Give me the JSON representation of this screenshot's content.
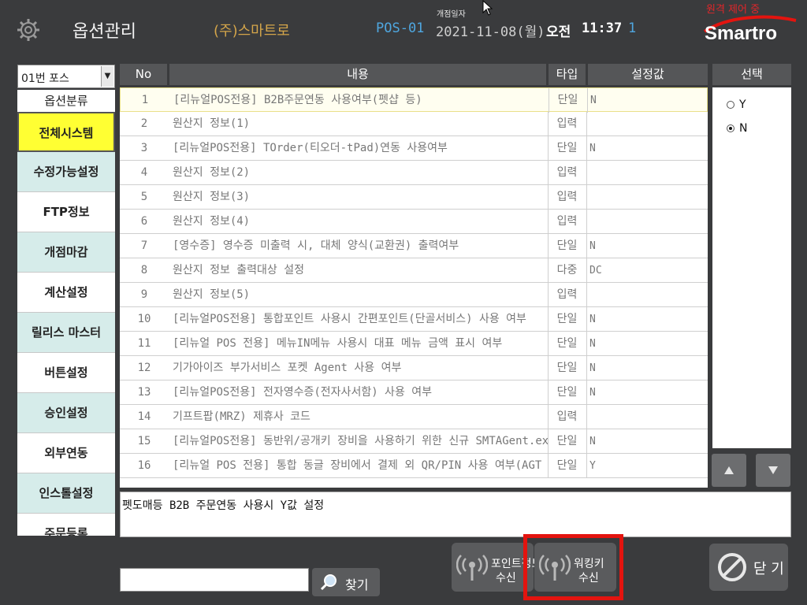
{
  "header": {
    "title": "옵션관리",
    "company": "(주)스마트로",
    "pos_id": "POS-01",
    "open_label": "개점일자",
    "date": "2021-11-08(월)",
    "ampm": "오전",
    "time": "11:37",
    "counter": "1",
    "remote_status": "원격 제어 중",
    "logo": "Smartro"
  },
  "left": {
    "pos_select": "01번 포스",
    "category_header": "옵션분류",
    "categories": [
      "전체시스템",
      "수정가능설정",
      "FTP정보",
      "개점마감",
      "계산설정",
      "릴리스 마스터",
      "버튼설정",
      "승인설정",
      "외부연동",
      "인스톨설정",
      "주문등록"
    ]
  },
  "table": {
    "headers": {
      "no": "No",
      "desc": "내용",
      "type": "타입",
      "value": "설정값"
    },
    "rows": [
      {
        "no": "1",
        "desc": "[리뉴얼POS전용] B2B주문연동 사용여부(펫샵 등)",
        "type": "단일",
        "value": "N"
      },
      {
        "no": "2",
        "desc": "원산지 정보(1)",
        "type": "입력",
        "value": ""
      },
      {
        "no": "3",
        "desc": "[리뉴얼POS전용] TOrder(티오더-tPad)연동 사용여부",
        "type": "단일",
        "value": "N"
      },
      {
        "no": "4",
        "desc": "원산지 정보(2)",
        "type": "입력",
        "value": ""
      },
      {
        "no": "5",
        "desc": "원산지 정보(3)",
        "type": "입력",
        "value": ""
      },
      {
        "no": "6",
        "desc": "원산지 정보(4)",
        "type": "입력",
        "value": ""
      },
      {
        "no": "7",
        "desc": "[영수증] 영수증 미출력 시, 대체 양식(교환권) 출력여부",
        "type": "단일",
        "value": "N"
      },
      {
        "no": "8",
        "desc": "원산지 정보 출력대상 설정",
        "type": "다중",
        "value": "DC"
      },
      {
        "no": "9",
        "desc": "원산지 정보(5)",
        "type": "입력",
        "value": ""
      },
      {
        "no": "10",
        "desc": "[리뉴얼POS전용] 통합포인트 사용시 간편포인트(단골서비스) 사용 여부",
        "type": "단일",
        "value": "N"
      },
      {
        "no": "11",
        "desc": "[리뉴얼 POS 전용] 메뉴IN메뉴 사용시 대표 메뉴 금액 표시 여부",
        "type": "단일",
        "value": "N"
      },
      {
        "no": "12",
        "desc": "기가아이즈 부가서비스 포켓 Agent 사용 여부",
        "type": "단일",
        "value": "N"
      },
      {
        "no": "13",
        "desc": "[리뉴얼POS전용] 전자영수증(전자사서함) 사용 여부",
        "type": "단일",
        "value": "N"
      },
      {
        "no": "14",
        "desc": "기프트팝(MRZ) 제휴사 코드",
        "type": "입력",
        "value": ""
      },
      {
        "no": "15",
        "desc": "[리뉴얼POS전용] 동반위/공개키 장비을 사용하기 위한 신규 SMTAGent.exe",
        "type": "단일",
        "value": "N"
      },
      {
        "no": "16",
        "desc": "[리뉴얼 POS 전용] 통합 동글 장비에서 결제 외 QR/PIN 사용 여부(AGT",
        "type": "단일",
        "value": "Y"
      }
    ]
  },
  "selection": {
    "header": "선택",
    "options": [
      {
        "label": "Y",
        "checked": false
      },
      {
        "label": "N",
        "checked": true
      }
    ]
  },
  "description": "펫도매등 B2B 주문연동 사용시 Y값 설정",
  "bottom": {
    "search_value": "",
    "find_label": "찾기",
    "point_btn": {
      "line1": "포인트정보",
      "line2": "수신"
    },
    "working_btn": {
      "line1": "워킹키",
      "line2": "수신"
    },
    "close_label": "닫 기"
  },
  "colors": {
    "background": "#3a3b3d",
    "selected_category": "#ffff33",
    "alt_category": "#d6ecea",
    "highlight_border": "#e3140f",
    "pos_id": "#4fa7e0",
    "company": "#d4a54a",
    "remote_status": "#e0262a"
  }
}
